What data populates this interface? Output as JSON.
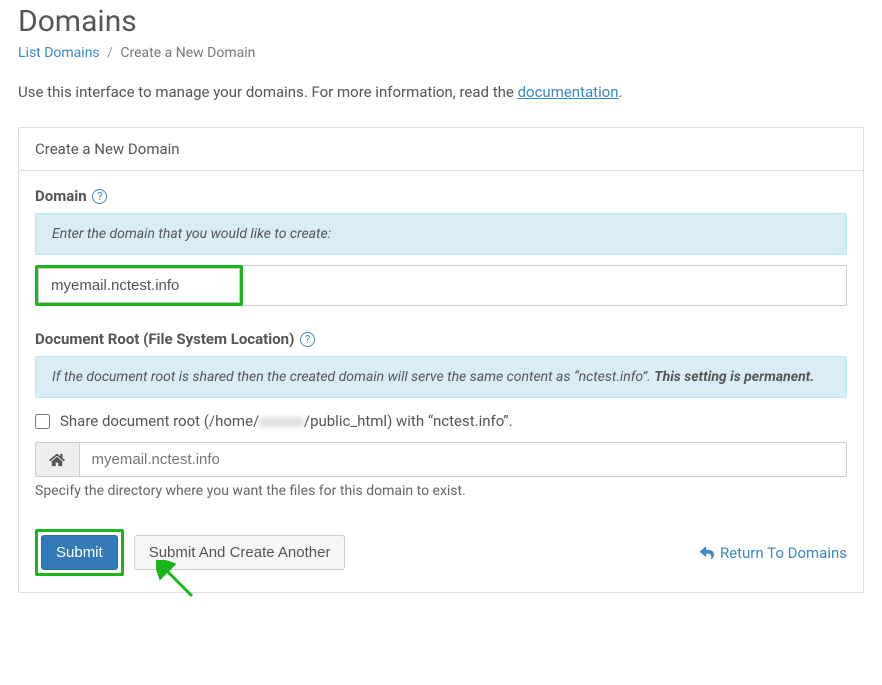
{
  "page": {
    "title": "Domains"
  },
  "breadcrumb": {
    "list_link": "List Domains",
    "current": "Create a New Domain"
  },
  "intro": {
    "prefix": "Use this interface to manage your domains. For more information, read the ",
    "link": "documentation",
    "suffix": "."
  },
  "panel": {
    "header": "Create a New Domain"
  },
  "domain_field": {
    "label": "Domain",
    "hint": "Enter the domain that you would like to create:",
    "value": "myemail.nctest.info"
  },
  "docroot_field": {
    "label": "Document Root (File System Location)",
    "hint_prefix": "If the document root is shared then the created domain will serve the same content as “nctest.info”. ",
    "hint_strong": "This setting is permanent."
  },
  "share_checkbox": {
    "prefix": "Share document root (/home/",
    "blurred": "xxxxxx",
    "middle": "/public_html) with “nctest.info”."
  },
  "docroot_input": {
    "value": "myemail.nctest.info",
    "helper": "Specify the directory where you want the files for this domain to exist."
  },
  "actions": {
    "submit": "Submit",
    "submit_another": "Submit And Create Another",
    "return": "Return To Domains"
  }
}
